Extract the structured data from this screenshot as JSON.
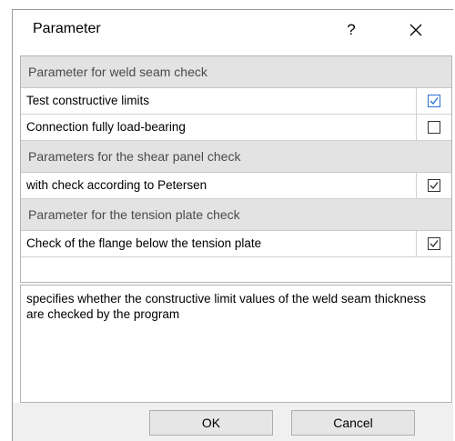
{
  "dialog": {
    "title": "Parameter",
    "help_label": "?",
    "close_icon": "close-icon"
  },
  "sections": [
    {
      "heading": "Parameter for weld seam check",
      "rows": [
        {
          "label": "Test constructive limits",
          "checked": true,
          "selected": true
        },
        {
          "label": "Connection fully load-bearing",
          "checked": false,
          "selected": false
        }
      ]
    },
    {
      "heading": "Parameters for the shear panel check",
      "rows": [
        {
          "label": "with check according to Petersen",
          "checked": true,
          "selected": false
        }
      ]
    },
    {
      "heading": "Parameter for the tension plate check",
      "rows": [
        {
          "label": "Check of the flange below the tension plate",
          "checked": true,
          "selected": false
        }
      ]
    }
  ],
  "description": "specifies whether the constructive limit values of the weld seam thickness are checked by the program",
  "buttons": {
    "ok": "OK",
    "cancel": "Cancel"
  },
  "colors": {
    "section_bg": "#e3e3e3",
    "check_accent": "#2a6fd1"
  }
}
